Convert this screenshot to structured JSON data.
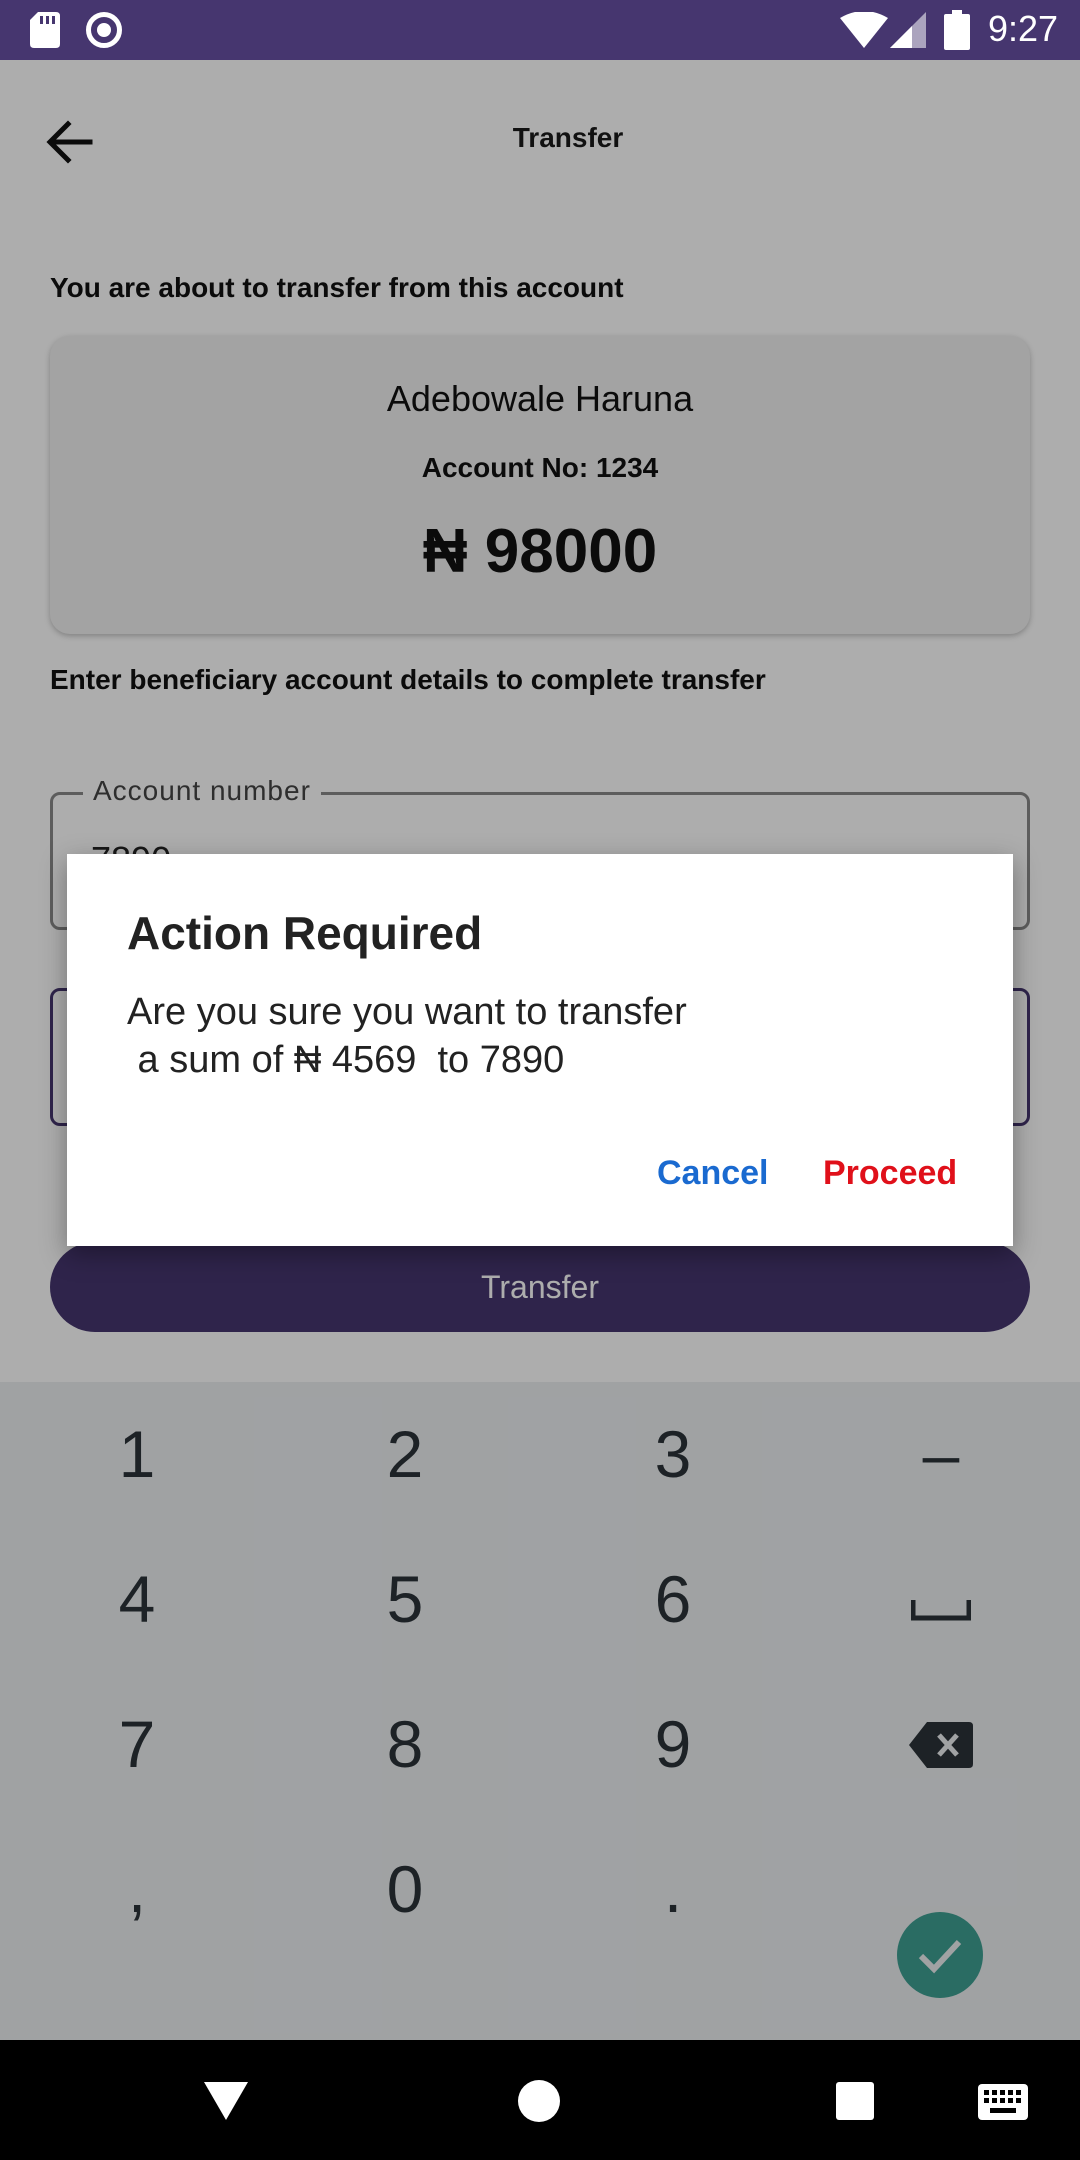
{
  "status_bar": {
    "time": "9:27",
    "icons": [
      "sd-card-icon",
      "record-icon",
      "wifi-icon",
      "cell-signal-icon",
      "battery-icon"
    ]
  },
  "header": {
    "title": "Transfer"
  },
  "source": {
    "label": "You are about to transfer from this account",
    "name": "Adebowale Haruna",
    "account_no": "Account No: 1234",
    "balance": "₦ 98000"
  },
  "beneficiary": {
    "label": "Enter beneficiary account details to complete transfer",
    "account_field": {
      "label": "Account number",
      "value": "7890"
    }
  },
  "transfer_button": {
    "label": "Transfer"
  },
  "dialog": {
    "title": "Action Required",
    "message": "Are you sure you want to transfer\n a sum of ₦ 4569  to 7890",
    "cancel_label": "Cancel",
    "proceed_label": "Proceed"
  },
  "keyboard": {
    "keys": [
      "1",
      "2",
      "3",
      "–",
      "4",
      "5",
      "6",
      "␣",
      "7",
      "8",
      "9",
      "⌫",
      ",",
      "0",
      ".",
      "✓"
    ]
  },
  "colors": {
    "primary": "#46366f",
    "cancel": "#1a6ad0",
    "proceed": "#e0101a",
    "ok_key": "#3f9f92"
  }
}
